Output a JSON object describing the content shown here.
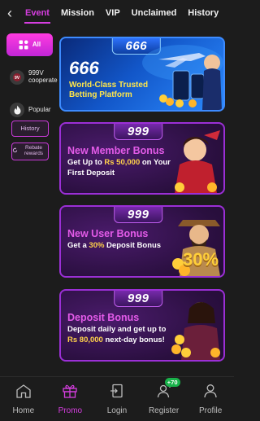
{
  "tabs": [
    "Event",
    "Mission",
    "VIP",
    "Unclaimed",
    "History"
  ],
  "active_tab": "Event",
  "sidebar": {
    "categories": [
      {
        "label": "All",
        "icon": "grid-icon"
      },
      {
        "label": "999V cooperate",
        "icon": "999v-logo-icon"
      },
      {
        "label": "Popular",
        "icon": "fire-icon"
      }
    ],
    "history_label": "History",
    "rebate_label": "Rebate rewards"
  },
  "banners": [
    {
      "brand": "666",
      "headline": "666",
      "tagline": "World-Class Trusted Betting Platform"
    },
    {
      "brand": "999",
      "title": "New Member Bonus",
      "lines": [
        "Get Up to ",
        "Rs 50,000",
        " on Your First Deposit"
      ]
    },
    {
      "brand": "999",
      "title": "New User Bonus",
      "lines": [
        "Get a ",
        "30%",
        " Deposit Bonus"
      ],
      "badge": "30%"
    },
    {
      "brand": "999",
      "title": "Deposit Bonus",
      "lines": [
        "Deposit daily and get up to ",
        "Rs 80,000",
        " next-day bonus!"
      ]
    }
  ],
  "bottom_nav": [
    {
      "label": "Home",
      "icon": "home-icon"
    },
    {
      "label": "Promo",
      "icon": "gift-icon"
    },
    {
      "label": "Login",
      "icon": "login-icon"
    },
    {
      "label": "Register",
      "icon": "register-icon",
      "badge": "+70"
    },
    {
      "label": "Profile",
      "icon": "profile-icon"
    }
  ],
  "active_nav": "Promo",
  "colors": {
    "accent": "#d63ee0",
    "background": "#1c1c1c",
    "highlight": "#ffd24a",
    "blue_card": "#1256c8",
    "purple_card": "#4a1b6b"
  }
}
